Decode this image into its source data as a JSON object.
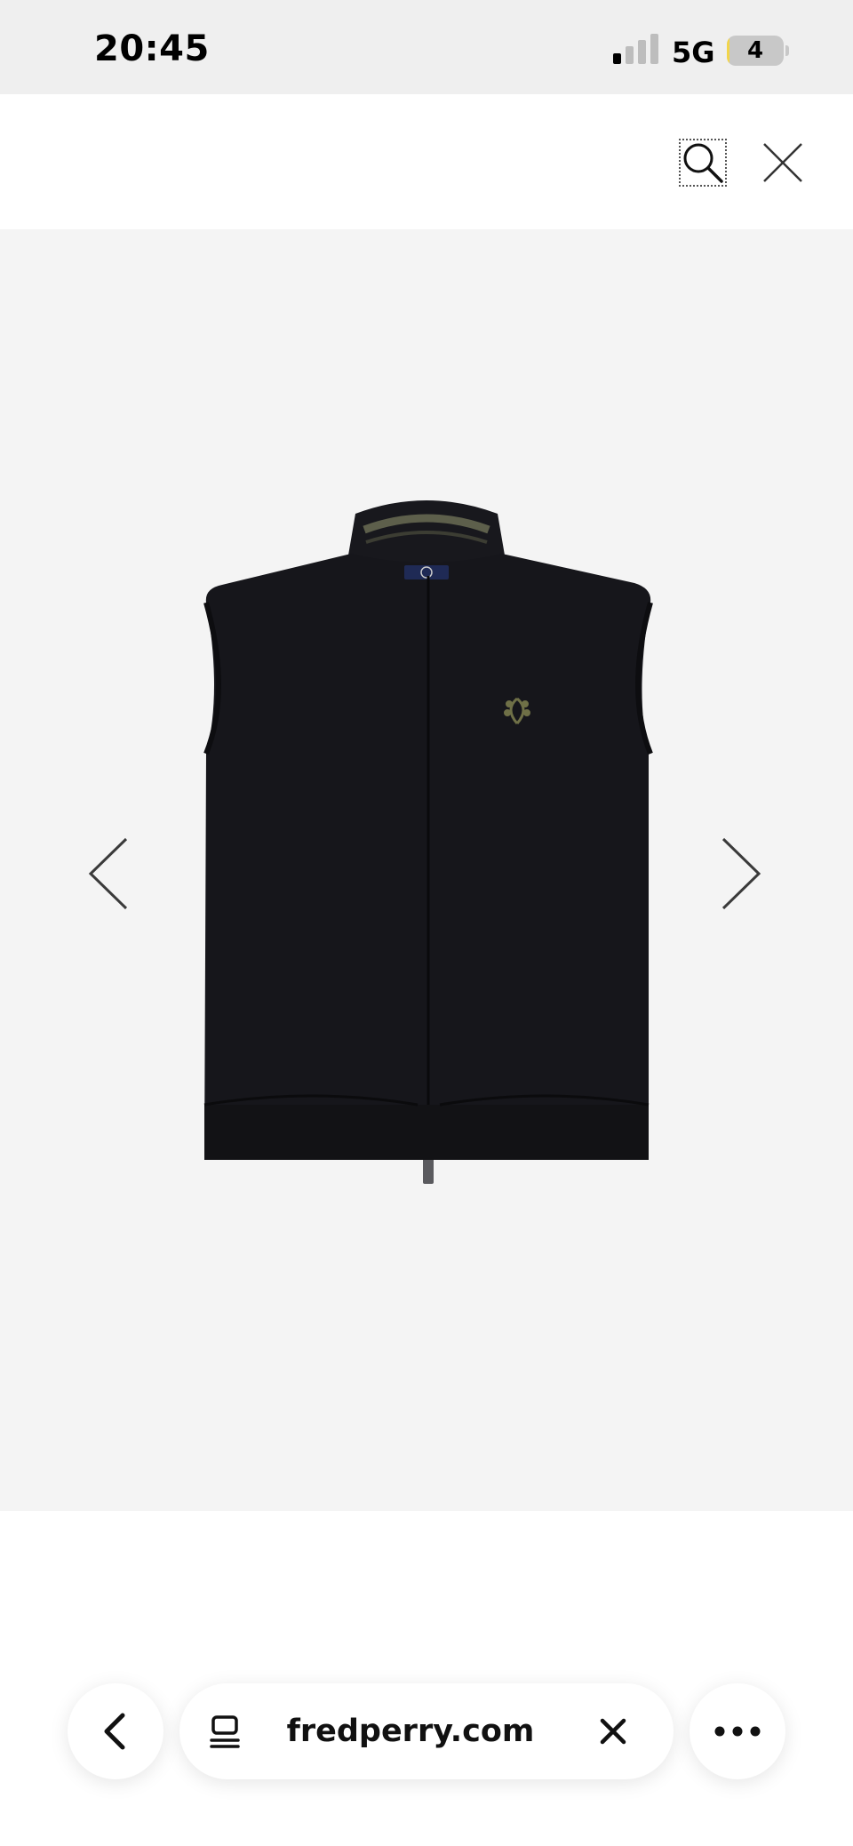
{
  "status_bar": {
    "time": "20:45",
    "network": "5G",
    "battery_level": "4",
    "battery_fraction": 0.04,
    "signal_bars_on": 1,
    "signal_bars_total": 4
  },
  "top_bar": {
    "icons": [
      "search-icon",
      "close-icon"
    ]
  },
  "gallery": {
    "product": "black zip-up sleeveless gilet with laurel wreath logo",
    "nav_icons": [
      "chevron-left-icon",
      "chevron-right-icon"
    ]
  },
  "browser_toolbar": {
    "url": "fredperry.com",
    "icons": [
      "back-arrow-icon",
      "tab-overview-icon",
      "clear-url-icon",
      "more-dots-icon"
    ]
  },
  "colors": {
    "status_bg": "#efefef",
    "gallery_bg": "#f4f4f4",
    "garment": "#16161b",
    "laurel": "#6f7047",
    "collar_tipping": "#5d5f4b"
  }
}
